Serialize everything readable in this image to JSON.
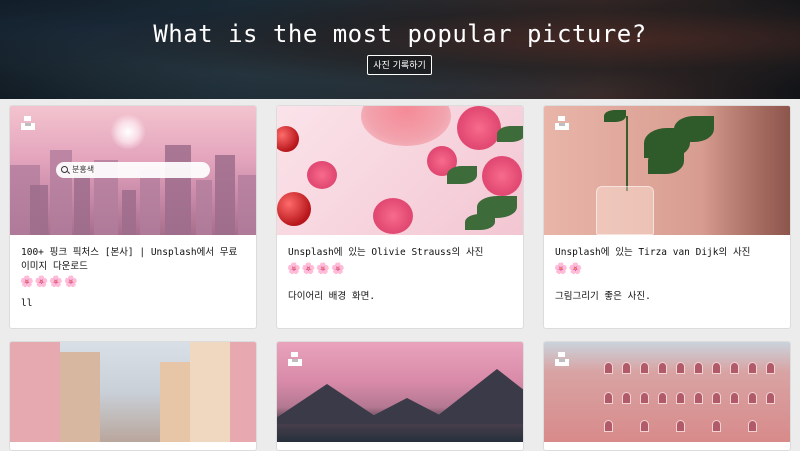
{
  "hero": {
    "title": "What is the most popular picture?",
    "button_label": "사진 기록하기"
  },
  "cards": [
    {
      "title": "100+ 핑크 픽처스 [본사] | Unsplash에서 무료 이미지 다운로드",
      "emoji": "🌸🌸🌸🌸",
      "description": "ll",
      "search_text": "분홍색",
      "image": "pink-city"
    },
    {
      "title": "Unsplash에 있는 Olivie Strauss의 사진",
      "emoji": "🌸🌸🌸🌸",
      "description": "다이어리 배경 화면.",
      "image": "cherries-and-flowers"
    },
    {
      "title": "Unsplash에 있는 Tirza van Dijk의 사진",
      "emoji": "🌸🌸",
      "description": "그림그리기 좋은 사진.",
      "image": "vase-with-leaves"
    },
    {
      "image": "pastel-street"
    },
    {
      "image": "pink-lake-mountains"
    },
    {
      "image": "pink-palace"
    }
  ],
  "icons": {
    "unsplash_badge": "unsplash-icon",
    "search": "search-icon"
  }
}
